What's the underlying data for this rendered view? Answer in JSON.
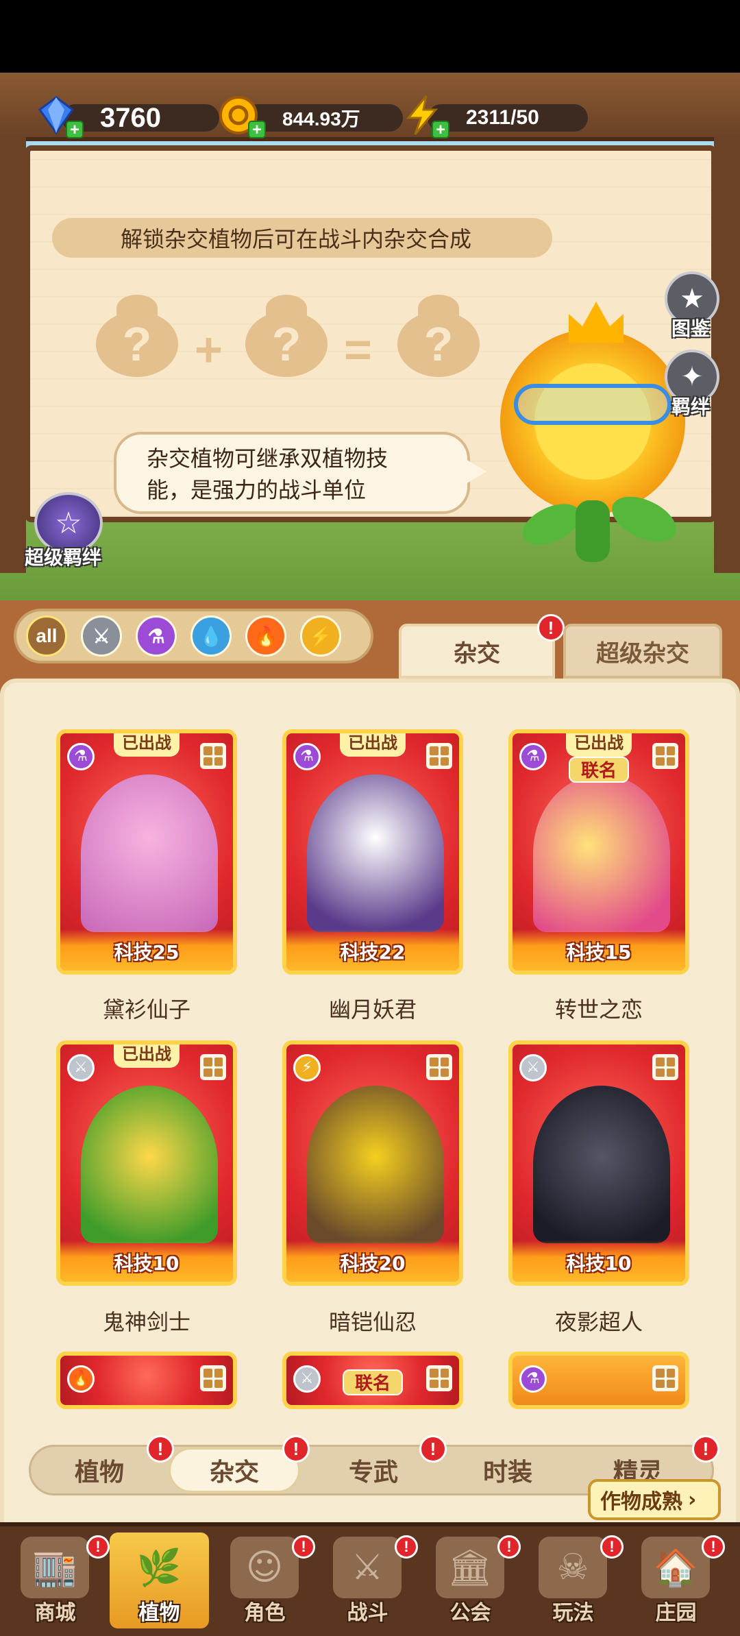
{
  "currencies": {
    "gems": "3760",
    "coins": "844.93万",
    "energy": "2311/50"
  },
  "intro": {
    "unlock_text": "解锁杂交植物后可在战斗内杂交合成",
    "formula": [
      "?",
      "+",
      "?",
      "=",
      "?"
    ],
    "bubble_line1": "杂交植物可继承双植物技",
    "bubble_line2": "能，是强力的战斗单位"
  },
  "side_buttons": {
    "codex": "图鉴",
    "bond": "羁绊",
    "super_bond": "超级羁绊"
  },
  "filters": [
    {
      "label": "all",
      "icon": "all-filter-icon",
      "color": "#9c6a34"
    },
    {
      "label": "",
      "icon": "sword-filter-icon",
      "color": "#8a8f99"
    },
    {
      "label": "",
      "icon": "potion-filter-icon",
      "color": "#9b4bd6"
    },
    {
      "label": "",
      "icon": "water-filter-icon",
      "color": "#3aa0e0"
    },
    {
      "label": "",
      "icon": "fire-filter-icon",
      "color": "#ff6a1a"
    },
    {
      "label": "",
      "icon": "lightning-filter-icon",
      "color": "#f0b020"
    }
  ],
  "top_tabs": {
    "hybrid": "杂交",
    "super_hybrid": "超级杂交",
    "alert": "!"
  },
  "cards": [
    {
      "name": "黛衫仙子",
      "level": "科技25",
      "badge": "已出战",
      "collab": "",
      "element": "potion-icon"
    },
    {
      "name": "幽月妖君",
      "level": "科技22",
      "badge": "已出战",
      "collab": "",
      "element": "potion-icon"
    },
    {
      "name": "转世之恋",
      "level": "科技15",
      "badge": "已出战",
      "collab": "联名",
      "element": "potion-icon"
    },
    {
      "name": "鬼神剑士",
      "level": "科技10",
      "badge": "已出战",
      "collab": "",
      "element": "sword-icon"
    },
    {
      "name": "暗铠仙忍",
      "level": "科技20",
      "badge": "",
      "collab": "",
      "element": "lightning-icon"
    },
    {
      "name": "夜影超人",
      "level": "科技10",
      "badge": "",
      "collab": "",
      "element": "sword-icon"
    },
    {
      "name": "",
      "level": "",
      "badge": "",
      "collab": "",
      "element": "fire-icon"
    },
    {
      "name": "",
      "level": "",
      "badge": "",
      "collab": "联名",
      "element": "sword-icon"
    },
    {
      "name": "",
      "level": "",
      "badge": "",
      "collab": "",
      "element": "potion-icon"
    }
  ],
  "sub_tabs": [
    "植物",
    "杂交",
    "专武",
    "时装",
    "精灵"
  ],
  "ripe_button": "作物成熟",
  "bottom_nav": [
    "商城",
    "植物",
    "角色",
    "战斗",
    "公会",
    "玩法",
    "庄园"
  ]
}
